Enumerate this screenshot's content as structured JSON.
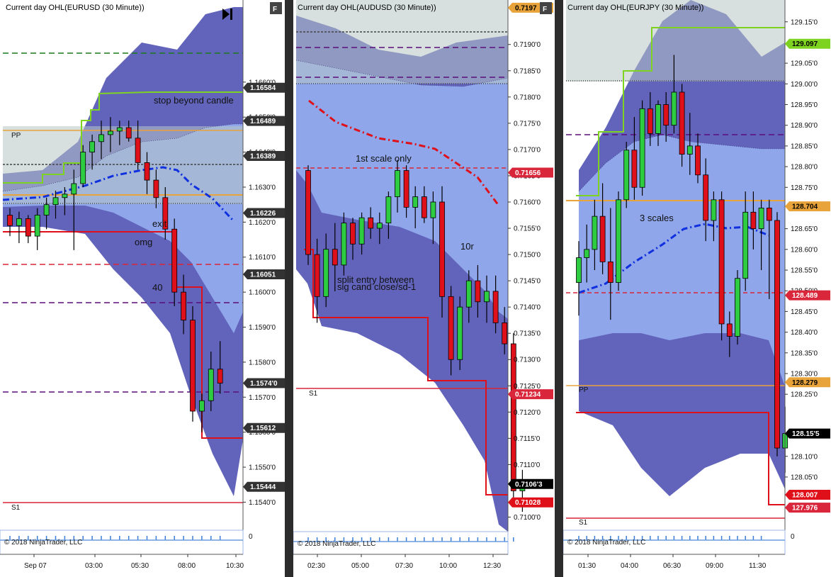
{
  "copyright": "© 2018 NinjaTrader, LLC",
  "chart_data": [
    {
      "type": "line",
      "title": "Current day OHL(EURUSD (30 Minute))",
      "symbol": "EURUSD",
      "ylim": [
        1.1533,
        1.1679
      ],
      "y_ticks": [
        "1.1660'0",
        "1.1650'0",
        "1.1640'0",
        "1.1630'0",
        "1.1620'0",
        "1.1610'0",
        "1.1600'0",
        "1.1590'0",
        "1.1580'0",
        "1.1570'0",
        "1.1560'0",
        "1.1550'0",
        "1.1540'0"
      ],
      "x_ticks": [
        "Sep 07",
        "03:00",
        "05:30",
        "08:00",
        "10:30"
      ],
      "price_tags": [
        {
          "label": "1.16584",
          "value": 1.16584,
          "color": "#333333"
        },
        {
          "label": "1.16489",
          "value": 1.16489,
          "color": "#333333"
        },
        {
          "label": "1.16389",
          "value": 1.16389,
          "color": "#333333"
        },
        {
          "label": "1.16226",
          "value": 1.16226,
          "color": "#333333"
        },
        {
          "label": "1.16051",
          "value": 1.16051,
          "color": "#333333"
        },
        {
          "label": "1.1574'0",
          "value": 1.1574,
          "color": "#333333"
        },
        {
          "label": "1.15612",
          "value": 1.15612,
          "color": "#333333"
        },
        {
          "label": "1.15444",
          "value": 1.15444,
          "color": "#333333"
        }
      ],
      "level_labels": [
        "PP",
        "S1"
      ],
      "annotations": [
        "stop beyond candle",
        "exit",
        "omg",
        "40"
      ],
      "oscillator_zero": "0",
      "candles": [
        [
          1.1622,
          1.1624,
          1.1616,
          1.1619
        ],
        [
          1.1619,
          1.1623,
          1.1614,
          1.1621
        ],
        [
          1.1621,
          1.1622,
          1.1614,
          1.1616
        ],
        [
          1.1616,
          1.1624,
          1.1612,
          1.1622
        ],
        [
          1.1622,
          1.1627,
          1.1618,
          1.1625
        ],
        [
          1.1625,
          1.1629,
          1.1621,
          1.1627
        ],
        [
          1.1627,
          1.163,
          1.1622,
          1.1628
        ],
        [
          1.1628,
          1.1635,
          1.1612,
          1.1631
        ],
        [
          1.1631,
          1.1642,
          1.163,
          1.164
        ],
        [
          1.164,
          1.1645,
          1.1635,
          1.1643
        ],
        [
          1.1643,
          1.1649,
          1.1638,
          1.1645
        ],
        [
          1.1645,
          1.165,
          1.164,
          1.1646
        ],
        [
          1.1646,
          1.1649,
          1.1642,
          1.1647
        ],
        [
          1.1647,
          1.1649,
          1.1643,
          1.1644
        ],
        [
          1.1644,
          1.1649,
          1.1635,
          1.1637
        ],
        [
          1.1637,
          1.164,
          1.1628,
          1.1632
        ],
        [
          1.1632,
          1.1635,
          1.1624,
          1.1627
        ],
        [
          1.1627,
          1.163,
          1.1615,
          1.1618
        ],
        [
          1.1618,
          1.1621,
          1.1596,
          1.16
        ],
        [
          1.16,
          1.1605,
          1.1588,
          1.1592
        ],
        [
          1.1592,
          1.1596,
          1.1563,
          1.1566
        ],
        [
          1.1566,
          1.1571,
          1.156,
          1.1569
        ],
        [
          1.1569,
          1.1583,
          1.1566,
          1.1578
        ],
        [
          1.1578,
          1.1586,
          1.1571,
          1.1574
        ]
      ]
    },
    {
      "type": "line",
      "title": "Current day OHL(AUDUSD (30 Minute))",
      "symbol": "AUDUSD",
      "ylim": [
        0.70975,
        0.71955
      ],
      "y_ticks": [
        "0.7190'0",
        "0.7185'0",
        "0.7180'0",
        "0.7175'0",
        "0.7170'0",
        "0.7165'0",
        "0.7160'0",
        "0.7155'0",
        "0.7150'0",
        "0.7145'0",
        "0.7140'0",
        "0.7135'0",
        "0.7130'0",
        "0.7125'0",
        "0.7120'0",
        "0.7115'0",
        "0.7110'0",
        "0.7100'0"
      ],
      "x_ticks": [
        "02:30",
        "05:00",
        "07:30",
        "10:00",
        "12:30"
      ],
      "price_tags": [
        {
          "label": "0.7197",
          "value": 0.7197,
          "color": "#e8a33a"
        },
        {
          "label": "0.71656",
          "value": 0.71656,
          "color": "#d9263a"
        },
        {
          "label": "0.71234",
          "value": 0.71234,
          "color": "#d9263a"
        },
        {
          "label": "0.7106'3",
          "value": 0.71063,
          "color": "#000000"
        },
        {
          "label": "0.71028",
          "value": 0.71028,
          "color": "#e0101a"
        }
      ],
      "level_labels": [
        "S1"
      ],
      "annotations": [
        "1st scale only",
        "split entry between",
        "sig cand close/sd-1",
        "10r"
      ],
      "candles": [
        [
          0.7166,
          0.7167,
          0.7148,
          0.715
        ],
        [
          0.715,
          0.7153,
          0.7137,
          0.7142
        ],
        [
          0.7142,
          0.7154,
          0.714,
          0.7151
        ],
        [
          0.7151,
          0.7156,
          0.7143,
          0.7148
        ],
        [
          0.7148,
          0.7158,
          0.7146,
          0.7156
        ],
        [
          0.7156,
          0.7157,
          0.7149,
          0.7152
        ],
        [
          0.7152,
          0.7158,
          0.715,
          0.7157
        ],
        [
          0.7157,
          0.7159,
          0.7153,
          0.7155
        ],
        [
          0.7155,
          0.7158,
          0.7152,
          0.7156
        ],
        [
          0.7156,
          0.7162,
          0.7153,
          0.7161
        ],
        [
          0.7161,
          0.7168,
          0.7158,
          0.7166
        ],
        [
          0.7166,
          0.7167,
          0.7157,
          0.7159
        ],
        [
          0.7159,
          0.7163,
          0.7155,
          0.7161
        ],
        [
          0.7161,
          0.7163,
          0.7156,
          0.7157
        ],
        [
          0.7157,
          0.7162,
          0.7152,
          0.716
        ],
        [
          0.716,
          0.7163,
          0.7138,
          0.7142
        ],
        [
          0.7142,
          0.7144,
          0.7127,
          0.713
        ],
        [
          0.713,
          0.7142,
          0.7128,
          0.714
        ],
        [
          0.714,
          0.7147,
          0.7137,
          0.7145
        ],
        [
          0.7145,
          0.7148,
          0.7138,
          0.7141
        ],
        [
          0.7141,
          0.7146,
          0.7137,
          0.7143
        ],
        [
          0.7143,
          0.7146,
          0.7135,
          0.7137
        ],
        [
          0.7137,
          0.714,
          0.7131,
          0.7133
        ],
        [
          0.7133,
          0.7135,
          0.7102,
          0.7105
        ],
        [
          0.7105,
          0.7109,
          0.7101,
          0.7106
        ]
      ]
    },
    {
      "type": "line",
      "title": "Current day OHL(EURJPY (30 Minute))",
      "symbol": "EURJPY",
      "ylim": [
        127.93,
        129.165
      ],
      "y_ticks": [
        "129.15'0",
        "129.05'0",
        "129.00'0",
        "128.95'0",
        "128.90'0",
        "128.85'0",
        "128.80'0",
        "128.75'0",
        "128.65'0",
        "128.60'0",
        "128.55'0",
        "128.50'0",
        "128.45'0",
        "128.40'0",
        "128.35'0",
        "128.30'0",
        "128.25'0",
        "128.10'0",
        "128.05'0"
      ],
      "x_ticks": [
        "01:30",
        "04:00",
        "06:30",
        "09:00",
        "11:30"
      ],
      "price_tags": [
        {
          "label": "129.097",
          "value": 129.097,
          "color": "#7ed321"
        },
        {
          "label": "128.704",
          "value": 128.704,
          "color": "#e8a33a"
        },
        {
          "label": "128.489",
          "value": 128.489,
          "color": "#d9263a"
        },
        {
          "label": "128.279",
          "value": 128.279,
          "color": "#e8a33a"
        },
        {
          "label": "128.15'5",
          "value": 128.155,
          "color": "#000000"
        },
        {
          "label": "128.007",
          "value": 128.007,
          "color": "#e0101a"
        },
        {
          "label": "127.976",
          "value": 127.976,
          "color": "#d9263a"
        }
      ],
      "level_labels": [
        "PP",
        "S1"
      ],
      "annotations": [
        "3 scales"
      ],
      "oscillator_zero": "0",
      "candles": [
        [
          128.52,
          128.62,
          128.44,
          128.58
        ],
        [
          128.58,
          128.66,
          128.52,
          128.6
        ],
        [
          128.6,
          128.72,
          128.55,
          128.68
        ],
        [
          128.68,
          128.76,
          128.54,
          128.57
        ],
        [
          128.57,
          128.7,
          128.43,
          128.52
        ],
        [
          128.52,
          128.74,
          128.5,
          128.72
        ],
        [
          128.72,
          128.86,
          128.7,
          128.84
        ],
        [
          128.84,
          128.92,
          128.72,
          128.75
        ],
        [
          128.75,
          128.96,
          128.73,
          128.94
        ],
        [
          128.94,
          128.98,
          128.85,
          128.88
        ],
        [
          128.88,
          128.96,
          128.85,
          128.95
        ],
        [
          128.95,
          128.98,
          128.86,
          128.9
        ],
        [
          128.9,
          129.07,
          128.88,
          128.98
        ],
        [
          128.98,
          129.0,
          128.8,
          128.83
        ],
        [
          128.83,
          128.93,
          128.78,
          128.85
        ],
        [
          128.85,
          128.88,
          128.76,
          128.78
        ],
        [
          128.78,
          128.82,
          128.62,
          128.67
        ],
        [
          128.67,
          128.74,
          128.62,
          128.72
        ],
        [
          128.72,
          128.74,
          128.38,
          128.42
        ],
        [
          128.42,
          128.45,
          128.34,
          128.39
        ],
        [
          128.39,
          128.55,
          128.37,
          128.53
        ],
        [
          128.53,
          128.74,
          128.5,
          128.69
        ],
        [
          128.69,
          128.74,
          128.6,
          128.65
        ],
        [
          128.65,
          128.72,
          128.55,
          128.7
        ],
        [
          128.7,
          128.72,
          128.48,
          128.67
        ],
        [
          128.67,
          128.69,
          128.1,
          128.12
        ],
        [
          128.12,
          128.22,
          128.06,
          128.155
        ]
      ]
    }
  ]
}
